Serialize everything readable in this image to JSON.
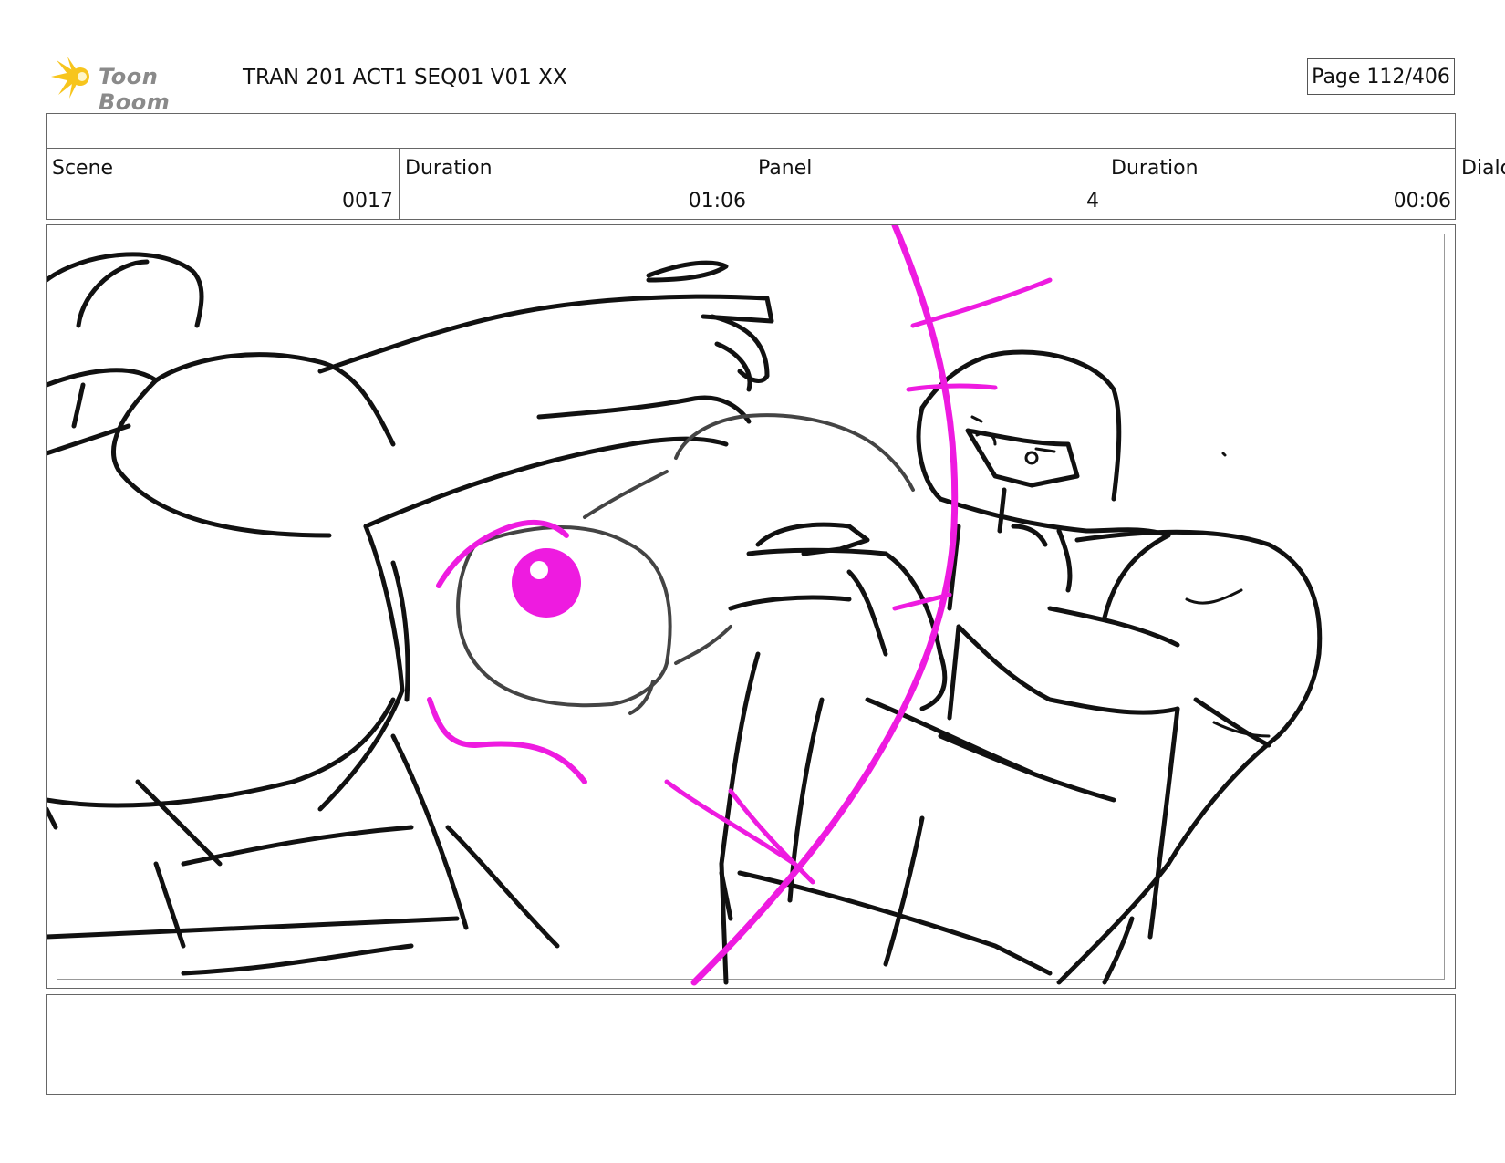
{
  "header": {
    "logo_text": "Toon Boom",
    "logo_icon": "starburst-logo-icon",
    "title": "TRAN 201 ACT1 SEQ01 V01 XX",
    "page": "Page 112/406"
  },
  "info": {
    "scene_label": "Scene",
    "scene_value": "0017",
    "duration_label": "Duration",
    "duration_value": "01:06",
    "panel_label": "Panel",
    "panel_value": "4",
    "panel_duration_label": "Duration",
    "panel_duration_value": "00:06",
    "dialog_label": "Dialo"
  },
  "colors": {
    "sketch_black": "#111111",
    "sketch_magenta": "#ee1be0",
    "logo_yellow": "#f7c51d"
  }
}
